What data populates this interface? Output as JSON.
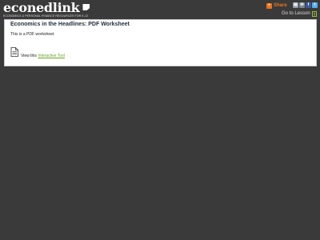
{
  "header": {
    "logo_text": "econedlink",
    "logo_mark_text": "Council for Economic Education",
    "tagline": "ECONOMICS & PERSONAL FINANCE RESOURCES FOR K-12",
    "share_label": "Share",
    "share_icon": "share-icon",
    "social_icons": [
      "print-icon",
      "email-icon",
      "facebook-icon",
      "twitter-icon"
    ],
    "goto_label": "Go to Lesson",
    "goto_icon": "lesson-icon",
    "colors": {
      "background": "#3a3a3a",
      "share": "#e8741c",
      "link": "#6aa22a"
    }
  },
  "content": {
    "title": "Economics in the Headlines: PDF Worksheet",
    "description": "This is a PDF worksheet.",
    "doc_icon": "document-icon",
    "view_prefix": "View this",
    "view_link": "Interactive Tool"
  }
}
